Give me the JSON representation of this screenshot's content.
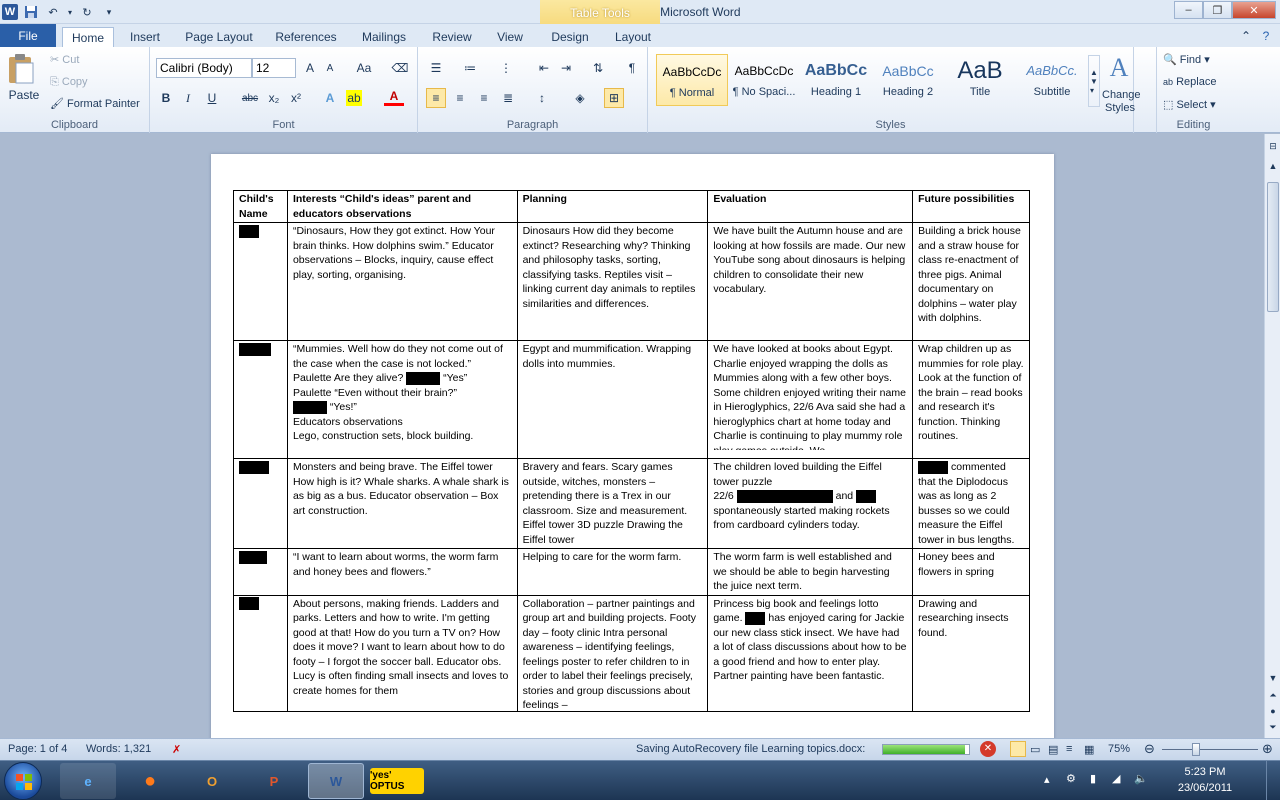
{
  "window": {
    "title": "Learning topics.docx - Microsoft Word",
    "context_tab": "Table Tools",
    "min": "–",
    "max": "❐",
    "close": "✕"
  },
  "tabs": [
    "File",
    "Home",
    "Insert",
    "Page Layout",
    "References",
    "Mailings",
    "Review",
    "View",
    "Design",
    "Layout"
  ],
  "active_tab": "Home",
  "clipboard": {
    "paste": "Paste",
    "cut": "Cut",
    "copy": "Copy",
    "format_painter": "Format Painter",
    "label": "Clipboard"
  },
  "font": {
    "name": "Calibri (Body)",
    "size": "12",
    "label": "Font",
    "bold": "B",
    "italic": "I",
    "underline": "U",
    "strike": "abc",
    "sub": "x₂",
    "sup": "x²",
    "grow": "A",
    "shrink": "A",
    "case": "Aa"
  },
  "paragraph": {
    "label": "Paragraph"
  },
  "styles": {
    "label": "Styles",
    "items": [
      {
        "preview": "AaBbCcDc",
        "name": "¶ Normal"
      },
      {
        "preview": "AaBbCcDc",
        "name": "¶ No Spaci..."
      },
      {
        "preview": "AaBbCc",
        "name": "Heading 1"
      },
      {
        "preview": "AaBbCc",
        "name": "Heading 2"
      },
      {
        "preview": "AaB",
        "name": "Title"
      },
      {
        "preview": "AaBbCc.",
        "name": "Subtitle"
      }
    ],
    "change": "Change Styles"
  },
  "editing": {
    "find": "Find",
    "replace": "Replace",
    "select": "Select",
    "label": "Editing"
  },
  "table": {
    "headers": [
      "Child's Name",
      "Interests  “Child's ideas” parent and educators observations",
      "Planning",
      "Evaluation",
      "Future possibilities"
    ],
    "rows": [
      {
        "interests": "“Dinosaurs,  How they got extinct.  How Your  brain thinks.  How dolphins  swim.” Educator observations – Blocks, inquiry, cause effect play, sorting, organising.",
        "planning": "Dinosaurs How did they become extinct? Researching why? Thinking and philosophy tasks, sorting, classifying tasks.  Reptiles visit – linking current day animals to reptiles similarities and differences.",
        "evaluation": "We have built the Autumn house and are looking at how fossils are made.  Our new YouTube song about dinosaurs is helping children to consolidate their new vocabulary.",
        "future": "Building a brick house and a straw house for class re-enactment of three pigs. Animal documentary on dolphins – water play with dolphins."
      },
      {
        "interests_a": "“Mummies.  Well how do they not come out of the case when the case is not locked.” Paulette  Are they alive?",
        "interests_b": "“Yes”",
        "interests_c": "Paulette “Even without their brain?”",
        "interests_d": "“Yes!”",
        "interests_e": "Educators observations",
        "interests_f": "Lego, construction sets, block building.",
        "planning": "Egypt and mummification. Wrapping dolls into mummies.",
        "evaluation": "We have looked at books about Egypt. Charlie enjoyed wrapping the dolls as Mummies along with a few other boys.  Some children enjoyed writing their name in Hieroglyphics, 22/6 Ava said she had a hieroglyphics chart at home today and Charlie is continuing to play mummy role play games outside.  We",
        "future": "Wrap children up as mummies for role play. Look at the function of the brain – read books and research it's function. Thinking routines."
      },
      {
        "interests": "Monsters and being brave.  The Eiffel tower How high is it?  Whale sharks.  A whale shark is as big as a bus. Educator observation – Box art construction.",
        "planning": "Bravery and fears.  Scary games outside, witches, monsters – pretending there is a Trex in our classroom. Size and measurement. Eiffel tower 3D puzzle Drawing the Eiffel tower",
        "evaluation_a": "The children loved building the Eiffel tower puzzle",
        "evaluation_b": "22/6",
        "evaluation_c": "and",
        "evaluation_d": "spontaneously started making rockets from cardboard cylinders today.",
        "future": "commented that the Diplodocus was as long as 2 busses so we could measure the Eiffel tower in bus lengths."
      },
      {
        "interests": "“I want to learn about worms, the worm farm and honey bees and flowers.”",
        "planning": "Helping to care for the worm farm.",
        "evaluation": "The worm farm is well established and we should be able to begin harvesting the juice next term.",
        "future": "Honey bees and flowers in spring"
      },
      {
        "interests": "About persons, making friends.  Ladders and parks.  Letters and how to write.  I'm getting good at that!  How do you turn a TV on?  How does it move?  I want to learn about how to do footy – I forgot the soccer ball.  Educator obs.  Lucy is often finding small insects and loves to create homes for them",
        "planning": "Collaboration – partner paintings and group art and building projects. Footy day – footy clinic Intra personal awareness – identifying feelings, feelings poster to refer children to in order to label their feelings precisely, stories and group discussions about feelings –",
        "evaluation_a": "Princess big book and feelings lotto game.",
        "evaluation_b": "has enjoyed caring for Jackie our new class stick insect.  We have had a lot of class discussions about how to be a good friend and how to enter play.  Partner painting have been fantastic.",
        "future": "Drawing and researching insects found."
      }
    ]
  },
  "status": {
    "page": "Page: 1 of 4",
    "words": "Words: 1,321",
    "saving": "Saving AutoRecovery file Learning topics.docx:",
    "zoom": "75%",
    "progress": 0.95
  },
  "taskbar": {
    "time": "5:23 PM",
    "date": "23/06/2011",
    "optus": "'yes' OPTUS"
  }
}
